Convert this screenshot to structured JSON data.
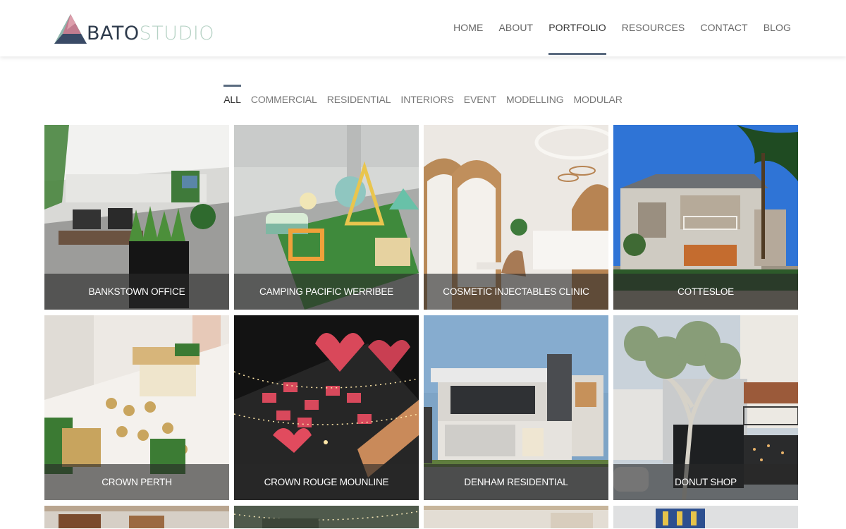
{
  "brand": {
    "part1": "BATO",
    "part2": "STUDIO"
  },
  "nav": [
    {
      "label": "HOME",
      "active": false
    },
    {
      "label": "ABOUT",
      "active": false
    },
    {
      "label": "PORTFOLIO",
      "active": true
    },
    {
      "label": "RESOURCES",
      "active": false
    },
    {
      "label": "CONTACT",
      "active": false
    },
    {
      "label": "BLOG",
      "active": false
    }
  ],
  "filters": [
    {
      "label": "ALL",
      "active": true
    },
    {
      "label": "COMMERCIAL",
      "active": false
    },
    {
      "label": "RESIDENTIAL",
      "active": false
    },
    {
      "label": "INTERIORS",
      "active": false
    },
    {
      "label": "EVENT",
      "active": false
    },
    {
      "label": "MODELLING",
      "active": false
    },
    {
      "label": "MODULAR",
      "active": false
    }
  ],
  "projects": [
    {
      "title": "BANKSTOWN OFFICE"
    },
    {
      "title": "CAMPING PACIFIC WERRIBEE"
    },
    {
      "title": "COSMETIC INJECTABLES CLINIC"
    },
    {
      "title": "COTTESLOE"
    },
    {
      "title": "CROWN PERTH"
    },
    {
      "title": "CROWN ROUGE MOUNLINE"
    },
    {
      "title": "DENHAM RESIDENTIAL"
    },
    {
      "title": "DONUT SHOP"
    }
  ],
  "colors": {
    "accent": "#5b6b80",
    "logo_dark": "#2e3b4c",
    "logo_light": "#b6d2c5"
  }
}
